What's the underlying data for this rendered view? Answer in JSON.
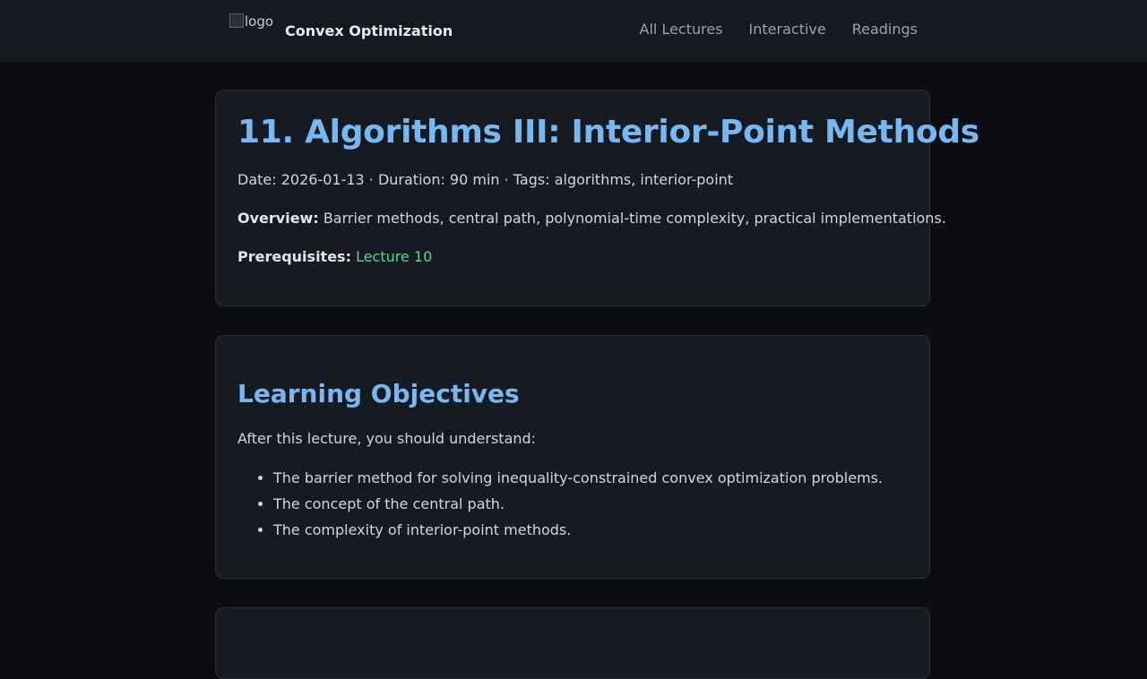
{
  "header": {
    "logo_alt": "logo",
    "site_title": "Convex Optimization",
    "nav": [
      {
        "label": "All Lectures"
      },
      {
        "label": "Interactive"
      },
      {
        "label": "Readings"
      }
    ]
  },
  "lecture": {
    "title": "11. Algorithms III: Interior-Point Methods",
    "meta": "Date: 2026-01-13 · Duration: 90 min · Tags: algorithms, interior-point",
    "overview_label": "Overview:",
    "overview_text": "Barrier methods, central path, polynomial-time complexity, practical implementations.",
    "prereq_label": "Prerequisites:",
    "prereq_link": "Lecture 10"
  },
  "objectives": {
    "heading": "Learning Objectives",
    "intro": "After this lecture, you should understand:",
    "items": [
      "The barrier method for solving inequality-constrained convex optimization problems.",
      "The concept of the central path.",
      "The complexity of interior-point methods."
    ]
  }
}
